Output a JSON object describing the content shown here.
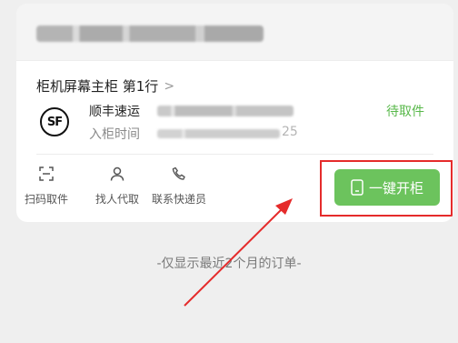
{
  "order": {
    "cabinet_label": "柜机屏幕主柜 第1行",
    "chevron": ">",
    "courier_logo_text": "SF",
    "courier_name": "顺丰速运",
    "status": "待取件",
    "time_label": "入柜时间",
    "time_suffix": "25"
  },
  "actions": [
    {
      "label": "扫码取件",
      "icon": "scan-icon"
    },
    {
      "label": "找人代取",
      "icon": "person-icon"
    },
    {
      "label": "联系快递员",
      "icon": "phone-icon"
    }
  ],
  "open_button": {
    "label": "一键开柜",
    "icon": "cabinet-icon"
  },
  "footer_note": "-仅显示最近2个月的订单-",
  "colors": {
    "accent_green": "#6cc35d",
    "status_green": "#58b84a",
    "annotation_red": "#e52b2b",
    "background": "#efefef"
  }
}
